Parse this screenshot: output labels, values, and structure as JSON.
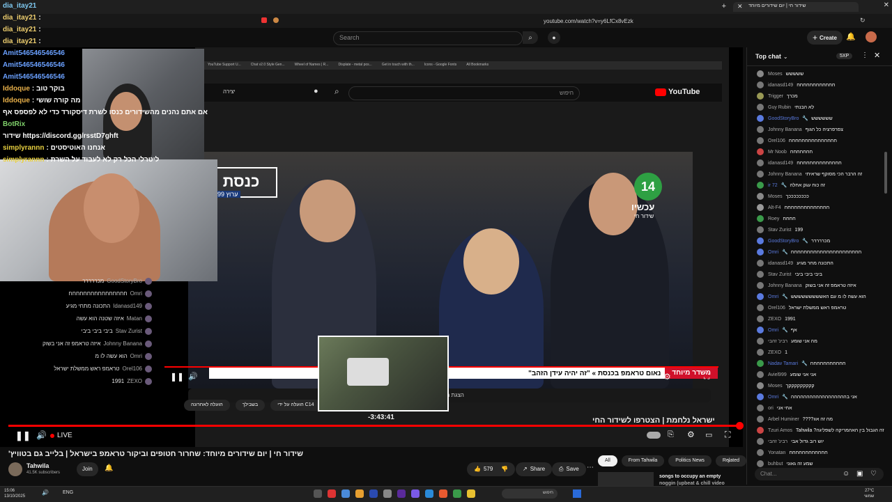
{
  "browser": {
    "tab_title": "שידור חי | יום שידורים מיוחד",
    "url": "youtube.com/watch?v=y6LfCx8vEzk"
  },
  "header": {
    "search_placeholder": "Search",
    "create_label": "Create"
  },
  "overlay_chat": [
    {
      "user": "dia_itay21",
      "text": "",
      "color": "#7ec8f0"
    },
    {
      "user": "dia_itay21",
      "text": ":",
      "color": "#f0d070"
    },
    {
      "user": "dia_itay21",
      "text": ":",
      "color": "#f0d070"
    },
    {
      "user": "dia_itay21",
      "text": ":",
      "color": "#f0d070"
    },
    {
      "user": "Amit546546546546",
      "text": "",
      "color": "#6aa0ff"
    },
    {
      "user": "Amit546546546546",
      "text": "",
      "color": "#6aa0ff"
    },
    {
      "user": "Amit546546546546",
      "text": "",
      "color": "#6aa0ff"
    },
    {
      "user": "Iddoque",
      "text": ": בוקר טוב",
      "color": "#e8b04a"
    },
    {
      "user": "Iddoque",
      "text": ": מה קורה שושי",
      "color": "#e8b04a"
    },
    {
      "user": "",
      "text": "אם אתם נהנים מהשידורים כנסו לשרת דיסקורד כדי לא לפספס אף",
      "color": "#ffffff"
    },
    {
      "user": "BotRix",
      "text": "",
      "color": "#7fd06a"
    },
    {
      "user": "",
      "text": "שידור https://discord.gg/rsstD7ghft",
      "color": "#ffffff"
    },
    {
      "user": "simplyrannn",
      "text": ": אנחנו האוטיסטים",
      "color": "#e8d040"
    },
    {
      "user": "simplyrannn",
      "text": ": ליטרלי הכל רק לא לעבוד על השרת",
      "color": "#e8d040"
    }
  ],
  "embedded_chat": [
    {
      "user": "GoodStoryBro",
      "text": "מכררררר"
    },
    {
      "user": "Omri",
      "text": "חחחחחחחחחחחחחחחח"
    },
    {
      "user": "Idanasd149",
      "text": "התכונה מתחי מגיע"
    },
    {
      "user": "Matan",
      "text": "איזה שטנה הוא עשה"
    },
    {
      "user": "Stav Zurist",
      "text": "ביבי ביבי ביבי"
    },
    {
      "user": "Johnny Banana",
      "text": "איזה טראמפ זה אני בשוק"
    },
    {
      "user": "Omri",
      "text": "הוא עשה לו מ"
    },
    {
      "user": "Orel106",
      "text": "טראמפ ראש ממשלת ישראל"
    },
    {
      "user": "ZEXO",
      "text": "1991"
    }
  ],
  "inner_browser": {
    "bookmarks": [
      "YouTube Support U...",
      "Chat v2.0 Style Gen...",
      "Wheel of Names | R...",
      "Displate - metal pos...",
      "Get in touch with th...",
      "Icons - Google Fonts",
      "All Bookmarks"
    ],
    "search_placeholder": "חיפוש",
    "create_label": "יצירה",
    "brand": "YouTube",
    "channel_logo": "כנסת",
    "channel_sub": "ערוץ 99",
    "live_logo": "14",
    "live_label": "עכשיו",
    "live_sub": "שידור חי",
    "ticker_left": "משדר מיוחד",
    "ticker_text": "נאום טראמפ בכנסת » \"זה יהיה עידן הזהב\"",
    "below_bar": "הצגת הצ'אט",
    "tags": [
      "הועלה לאחרונה",
      "בשבילך",
      "הועלה על ידי C14"
    ],
    "headline": "ישראל נלחמת | הצטרפו לשידור החי"
  },
  "player": {
    "live_label": "LIVE",
    "time_preview": "-3:43:41",
    "progress": 0.99
  },
  "video": {
    "title": "שידור חי | יום שידורים מיוחד: שחרור חטופים וביקור טראמפ בישראל | בלייב גם בטוויץ'",
    "channel_name": "Tahwila",
    "subscribers": "41.5K subscribers",
    "join_label": "Join",
    "likes": "579",
    "share_label": "Share",
    "save_label": "Save"
  },
  "filters": [
    "All",
    "From Tahwila",
    "Politics News",
    "Related"
  ],
  "recommended": {
    "title": "songs to occupy an empty",
    "subtitle": "noggin (upbeat & chill video"
  },
  "chat": {
    "header": "Top chat",
    "badge": "5XP",
    "input_placeholder": "Chat...",
    "messages": [
      {
        "user": "Moses",
        "text": "ששששש",
        "color": "#888"
      },
      {
        "user": "idanasd149",
        "text": "חחחחחחחחחחחח",
        "color": "#777"
      },
      {
        "user": "Trigger",
        "text": "מכרך",
        "color": "#995"
      },
      {
        "user": "Guy Rubin",
        "text": "לא הבנתי",
        "color": "#777"
      },
      {
        "user": "GoodStoryBro",
        "text": "שששששש",
        "color": "#5a7adf",
        "mod": true
      },
      {
        "user": "Johnny Banana",
        "text": "צפרפרציה כל הגוף",
        "color": "#777"
      },
      {
        "user": "Orel106",
        "text": "חחחחחחחחחחחחחחח",
        "color": "#777"
      },
      {
        "user": "Mr Noob",
        "text": "חחחחחחח",
        "color": "#c44"
      },
      {
        "user": "idanasd149",
        "text": "חחחחחחחחחחחחחח",
        "color": "#777"
      },
      {
        "user": "Johnny Banana",
        "text": "זה הרבר הכי מסוקף שראיתי",
        "color": "#777"
      },
      {
        "user": "ir 72",
        "text": "זה כוח עגק אחלה",
        "color": "#3a9a4a",
        "mod": true
      },
      {
        "user": "Moses",
        "text": "ככככככככך",
        "color": "#888"
      },
      {
        "user": "Alt-F4",
        "text": "חחחחחחחחחחחחחח",
        "color": "#999"
      },
      {
        "user": "Roey",
        "text": "חחחח",
        "color": "#3a9a4a"
      },
      {
        "user": "Stav Zurist",
        "text": "199",
        "color": "#777"
      },
      {
        "user": "GoodStoryBro",
        "text": "מכררררר",
        "color": "#5a7adf",
        "mod": true
      },
      {
        "user": "Omri",
        "text": "חחחחחחחחחחחחחחחחחחחחחח",
        "color": "#5a7adf",
        "mod": true
      },
      {
        "user": "idanasd149",
        "text": "התכונה מחר מגיע",
        "color": "#777"
      },
      {
        "user": "Stav Zurist",
        "text": "ביבי ביבי ביבי",
        "color": "#777"
      },
      {
        "user": "Johnny Banana",
        "text": "איזה טראמפ זה אני בשוק",
        "color": "#777"
      },
      {
        "user": "Omri",
        "text": "הוא עשה לו מ עם האששששששששש",
        "color": "#5a7adf",
        "mod": true
      },
      {
        "user": "Orel106",
        "text": "טראמפ ראש ממשלת ישראל",
        "color": "#777"
      },
      {
        "user": "ZEXO",
        "text": "1991",
        "color": "#777"
      },
      {
        "user": "Omri",
        "text": "אף",
        "color": "#5a7adf",
        "mod": true
      },
      {
        "user": "רבינ' זהבי",
        "text": "מה אני שומע",
        "color": "#777"
      },
      {
        "user": "ZEXO",
        "text": "1",
        "color": "#777"
      },
      {
        "user": "Nadav Tamari",
        "text": "חחחחחחחחחחח",
        "color": "#3a9a4a",
        "mod": true
      },
      {
        "user": "Aviel999",
        "text": "אני אני שומע",
        "color": "#777"
      },
      {
        "user": "Moses",
        "text": "קקקקקקקקקך",
        "color": "#888"
      },
      {
        "user": "Omri",
        "text": "אני בהההההההההההההההההה",
        "color": "#5a7adf",
        "mod": true
      },
      {
        "user": "ori",
        "text": "אחי אני",
        "color": "#777"
      },
      {
        "user": "Arbel Huminer",
        "text": "מה זה אוו????",
        "color": "#777"
      },
      {
        "user": "Tzuri Amos",
        "text": "זה הגבול בין האהמריקה לשפליגה? Tahwila",
        "color": "#c44"
      },
      {
        "user": "רבינ' זהבי",
        "text": "יוש רוב גדול אבי",
        "color": "#777"
      },
      {
        "user": "Yonatan",
        "text": "חחחחחחחחחחחח",
        "color": "#777"
      },
      {
        "user": "buhbut",
        "text": "שמע זה גאוני",
        "color": "#777"
      }
    ]
  },
  "taskbar": {
    "time": "15:06",
    "date": "13/10/2025",
    "lang": "ENG",
    "search_placeholder": "חיפוש",
    "weather_temp": "27°C",
    "weather_label": "שמשי"
  },
  "colors": {
    "accent": "#ff0000",
    "bg": "#0f0f0f",
    "mod": "#5a7adf"
  }
}
